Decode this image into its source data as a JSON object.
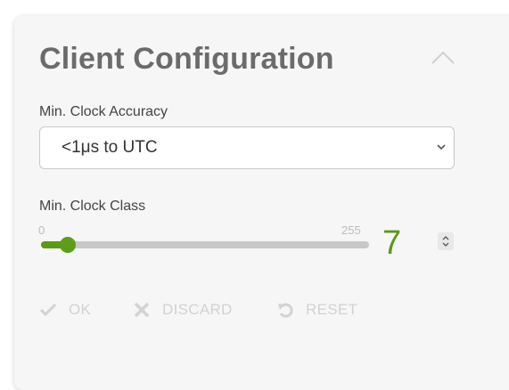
{
  "panel": {
    "title": "Client Configuration"
  },
  "clock_accuracy": {
    "label": "Min. Clock Accuracy",
    "selected": "<1μs to UTC"
  },
  "clock_class": {
    "label": "Min. Clock Class",
    "min": "0",
    "max": "255",
    "value": "7",
    "value_number": 7
  },
  "actions": {
    "ok": "OK",
    "discard": "DISCARD",
    "reset": "RESET"
  },
  "colors": {
    "accent": "#5a9a14",
    "disabled": "#d2d2d2"
  },
  "icons": {
    "collapse": "chevron-up-icon",
    "select": "chevron-down-icon",
    "stepper": "up-down-arrows-icon",
    "ok": "check-icon",
    "discard": "x-icon",
    "reset": "undo-icon"
  }
}
